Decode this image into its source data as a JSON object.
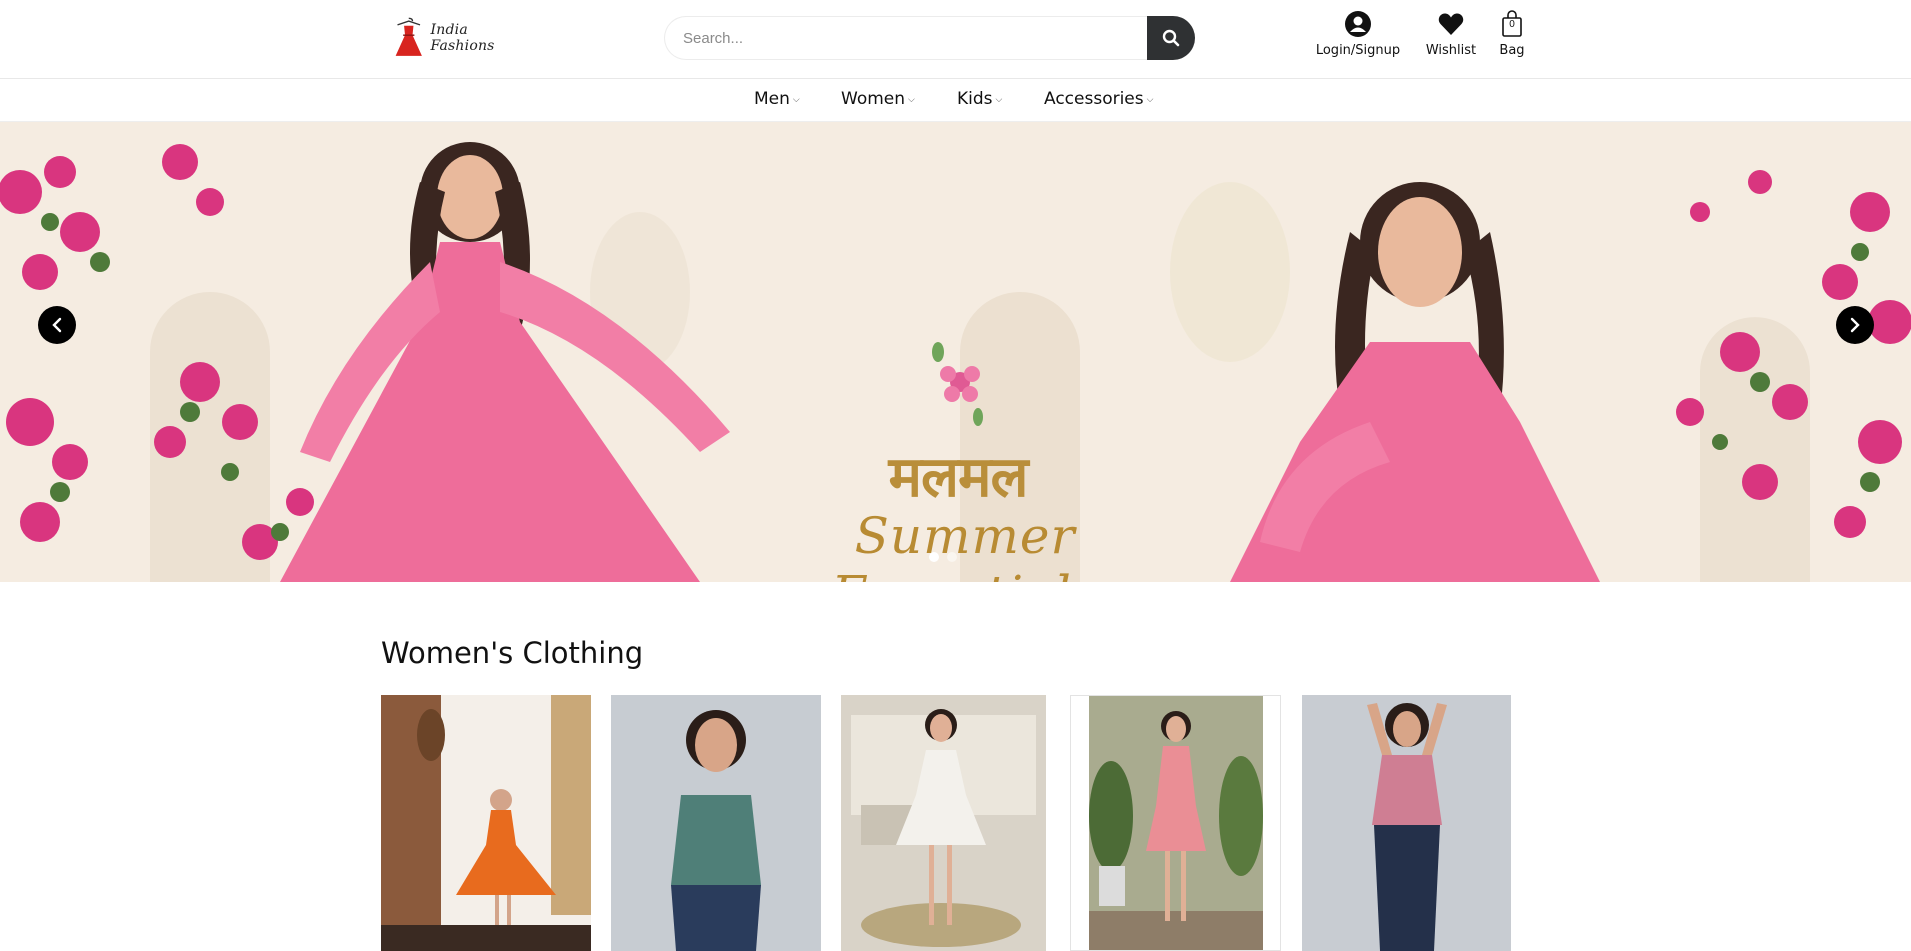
{
  "brand": {
    "name": "India Fashions"
  },
  "search": {
    "placeholder": "Search..."
  },
  "header_actions": {
    "login_label": "Login/Signup",
    "wishlist_label": "Wishlist",
    "bag_label": "Bag",
    "bag_count": "0"
  },
  "nav": {
    "items": [
      {
        "label": "Men",
        "icon": "chevron-down-icon"
      },
      {
        "label": "Women",
        "icon": "chevron-down-icon"
      },
      {
        "label": "Kids",
        "icon": "chevron-down-icon"
      },
      {
        "label": "Accessories",
        "icon": "chevron-down-icon"
      }
    ]
  },
  "hero": {
    "title": "मलमल",
    "subtitle": "Summer Essentials",
    "slides": 2,
    "active_slide": 1
  },
  "section": {
    "title": "Women's Clothing"
  },
  "products": [
    {
      "name": "orange-dress",
      "color": "#e86b1e"
    },
    {
      "name": "teal-top",
      "color": "#4f7f78"
    },
    {
      "name": "white-dress",
      "color": "#f3f1ec"
    },
    {
      "name": "pink-dress",
      "color": "#ea8e95"
    },
    {
      "name": "pink-top",
      "color": "#cf7e93"
    }
  ],
  "colors": {
    "accent_dark": "#2f3133",
    "hero_pink": "#ee6d9a",
    "hero_gold": "#b98e3a"
  }
}
